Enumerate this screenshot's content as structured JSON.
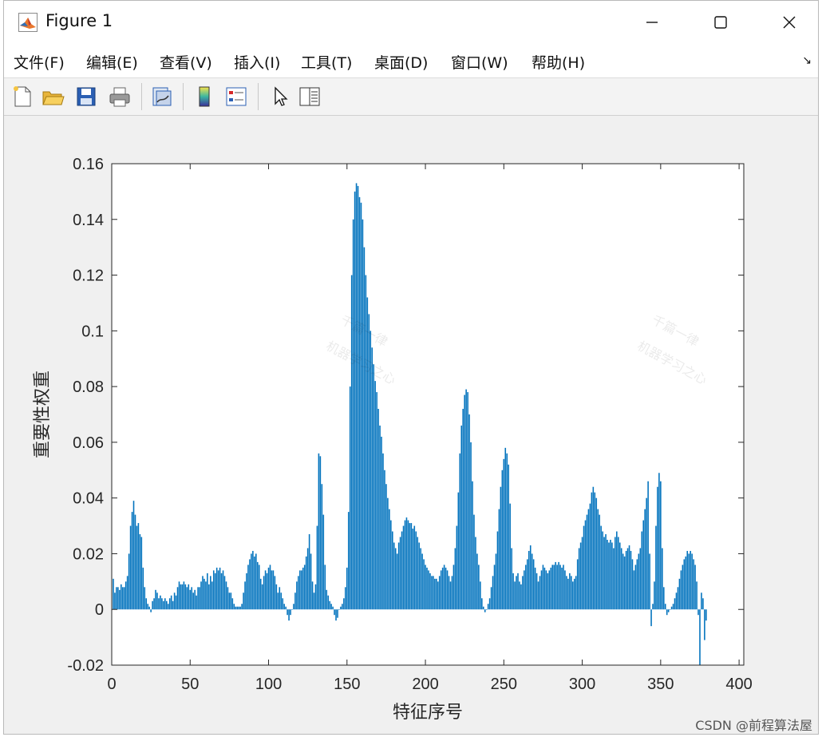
{
  "window": {
    "title": "Figure 1"
  },
  "menu": {
    "items": [
      "文件(F)",
      "编辑(E)",
      "查看(V)",
      "插入(I)",
      "工具(T)",
      "桌面(D)",
      "窗口(W)",
      "帮助(H)"
    ],
    "arrow": "↘"
  },
  "toolbar": {
    "icons": [
      "new-figure-icon",
      "open-file-icon",
      "save-icon",
      "print-icon",
      "link-icon",
      "colorbar-icon",
      "legend-icon",
      "pointer-icon",
      "property-editor-icon"
    ]
  },
  "watermarks": [
    "千篇一律",
    "机器学习之心",
    "千篇一律",
    "机器学习之心"
  ],
  "credit": "CSDN @前程算法屋",
  "chart_data": {
    "type": "bar",
    "title": "",
    "xlabel": "特征序号",
    "ylabel": "重要性权重",
    "xlim": [
      0,
      403
    ],
    "ylim": [
      -0.02,
      0.16
    ],
    "xticks": [
      "0",
      "50",
      "100",
      "150",
      "200",
      "250",
      "300",
      "350",
      "400"
    ],
    "xtick_values": [
      0,
      50,
      100,
      150,
      200,
      250,
      300,
      350,
      400
    ],
    "yticks": [
      "-0.02",
      "0",
      "0.02",
      "0.04",
      "0.06",
      "0.08",
      "0.1",
      "0.12",
      "0.14",
      "0.16"
    ],
    "ytick_values": [
      -0.02,
      0,
      0.02,
      0.04,
      0.06,
      0.08,
      0.1,
      0.12,
      0.14,
      0.16
    ],
    "bar_color": "#0072bd",
    "grid": false,
    "x": [
      1,
      2,
      3,
      4,
      5,
      6,
      7,
      8,
      9,
      10,
      11,
      12,
      13,
      14,
      15,
      16,
      17,
      18,
      19,
      20,
      21,
      22,
      23,
      24,
      25,
      26,
      27,
      28,
      29,
      30,
      31,
      32,
      33,
      34,
      35,
      36,
      37,
      38,
      39,
      40,
      41,
      42,
      43,
      44,
      45,
      46,
      47,
      48,
      49,
      50,
      51,
      52,
      53,
      54,
      55,
      56,
      57,
      58,
      59,
      60,
      61,
      62,
      63,
      64,
      65,
      66,
      67,
      68,
      69,
      70,
      71,
      72,
      73,
      74,
      75,
      76,
      77,
      78,
      79,
      80,
      81,
      82,
      83,
      84,
      85,
      86,
      87,
      88,
      89,
      90,
      91,
      92,
      93,
      94,
      95,
      96,
      97,
      98,
      99,
      100,
      101,
      102,
      103,
      104,
      105,
      106,
      107,
      108,
      109,
      110,
      111,
      112,
      113,
      114,
      115,
      116,
      117,
      118,
      119,
      120,
      121,
      122,
      123,
      124,
      125,
      126,
      127,
      128,
      129,
      130,
      131,
      132,
      133,
      134,
      135,
      136,
      137,
      138,
      139,
      140,
      141,
      142,
      143,
      144,
      145,
      146,
      147,
      148,
      149,
      150,
      151,
      152,
      153,
      154,
      155,
      156,
      157,
      158,
      159,
      160,
      161,
      162,
      163,
      164,
      165,
      166,
      167,
      168,
      169,
      170,
      171,
      172,
      173,
      174,
      175,
      176,
      177,
      178,
      179,
      180,
      181,
      182,
      183,
      184,
      185,
      186,
      187,
      188,
      189,
      190,
      191,
      192,
      193,
      194,
      195,
      196,
      197,
      198,
      199,
      200,
      201,
      202,
      203,
      204,
      205,
      206,
      207,
      208,
      209,
      210,
      211,
      212,
      213,
      214,
      215,
      216,
      217,
      218,
      219,
      220,
      221,
      222,
      223,
      224,
      225,
      226,
      227,
      228,
      229,
      230,
      231,
      232,
      233,
      234,
      235,
      236,
      237,
      238,
      239,
      240,
      241,
      242,
      243,
      244,
      245,
      246,
      247,
      248,
      249,
      250,
      251,
      252,
      253,
      254,
      255,
      256,
      257,
      258,
      259,
      260,
      261,
      262,
      263,
      264,
      265,
      266,
      267,
      268,
      269,
      270,
      271,
      272,
      273,
      274,
      275,
      276,
      277,
      278,
      279,
      280,
      281,
      282,
      283,
      284,
      285,
      286,
      287,
      288,
      289,
      290,
      291,
      292,
      293,
      294,
      295,
      296,
      297,
      298,
      299,
      300,
      301,
      302,
      303,
      304,
      305,
      306,
      307,
      308,
      309,
      310,
      311,
      312,
      313,
      314,
      315,
      316,
      317,
      318,
      319,
      320,
      321,
      322,
      323,
      324,
      325,
      326,
      327,
      328,
      329,
      330,
      331,
      332,
      333,
      334,
      335,
      336,
      337,
      338,
      339,
      340,
      341,
      342,
      343,
      344,
      345,
      346,
      347,
      348,
      349,
      350,
      351,
      352,
      353,
      354,
      355,
      356,
      357,
      358,
      359,
      360,
      361,
      362,
      363,
      364,
      365,
      366,
      367,
      368,
      369,
      370,
      371,
      372,
      373,
      374,
      375,
      376,
      377,
      378,
      379,
      380,
      381,
      382,
      383,
      384,
      385,
      386,
      387,
      388,
      389,
      390,
      391,
      392,
      393,
      394,
      395,
      396,
      397,
      398,
      399,
      400,
      401,
      402,
      403
    ],
    "values": [
      0.011,
      0.006,
      0.008,
      0.008,
      0.007,
      0.009,
      0.008,
      0.008,
      0.01,
      0.012,
      0.02,
      0.03,
      0.035,
      0.039,
      0.034,
      0.03,
      0.031,
      0.027,
      0.026,
      0.015,
      0.008,
      0.004,
      0.002,
      0.001,
      -0.001,
      0.003,
      0.004,
      0.007,
      0.006,
      0.004,
      0.005,
      0.004,
      0.003,
      0.004,
      0.003,
      0.002,
      0.004,
      0.005,
      0.003,
      0.006,
      0.005,
      0.008,
      0.01,
      0.009,
      0.009,
      0.01,
      0.009,
      0.008,
      0.009,
      0.007,
      0.008,
      0.006,
      0.007,
      0.005,
      0.008,
      0.008,
      0.01,
      0.012,
      0.011,
      0.01,
      0.013,
      0.009,
      0.012,
      0.01,
      0.014,
      0.013,
      0.015,
      0.014,
      0.015,
      0.013,
      0.014,
      0.012,
      0.01,
      0.008,
      0.006,
      0.006,
      0.004,
      0.002,
      0.001,
      0.001,
      0.001,
      0.001,
      0.002,
      0.006,
      0.01,
      0.013,
      0.016,
      0.018,
      0.02,
      0.021,
      0.019,
      0.02,
      0.017,
      0.016,
      0.011,
      0.009,
      0.012,
      0.014,
      0.013,
      0.015,
      0.016,
      0.014,
      0.014,
      0.012,
      0.009,
      0.006,
      0.008,
      0.006,
      0.004,
      0.002,
      0.001,
      -0.002,
      -0.004,
      -0.002,
      0.0,
      0.002,
      0.006,
      0.01,
      0.012,
      0.014,
      0.014,
      0.015,
      0.016,
      0.019,
      0.022,
      0.027,
      0.02,
      0.01,
      0.006,
      0.009,
      0.03,
      0.056,
      0.055,
      0.045,
      0.034,
      0.016,
      0.007,
      0.005,
      0.003,
      0.002,
      0.001,
      -0.002,
      -0.004,
      -0.003,
      0.0,
      0.001,
      0.002,
      0.004,
      0.008,
      0.015,
      0.035,
      0.08,
      0.12,
      0.14,
      0.15,
      0.153,
      0.152,
      0.148,
      0.146,
      0.14,
      0.13,
      0.12,
      0.112,
      0.106,
      0.1,
      0.094,
      0.088,
      0.082,
      0.078,
      0.072,
      0.066,
      0.062,
      0.056,
      0.05,
      0.045,
      0.04,
      0.036,
      0.032,
      0.028,
      0.024,
      0.022,
      0.02,
      0.024,
      0.026,
      0.028,
      0.03,
      0.032,
      0.033,
      0.032,
      0.031,
      0.031,
      0.029,
      0.03,
      0.028,
      0.026,
      0.024,
      0.022,
      0.02,
      0.018,
      0.016,
      0.015,
      0.014,
      0.013,
      0.012,
      0.012,
      0.011,
      0.011,
      0.01,
      0.012,
      0.014,
      0.015,
      0.016,
      0.015,
      0.014,
      0.012,
      0.01,
      0.012,
      0.016,
      0.022,
      0.03,
      0.042,
      0.056,
      0.066,
      0.072,
      0.077,
      0.079,
      0.078,
      0.07,
      0.06,
      0.046,
      0.034,
      0.026,
      0.02,
      0.016,
      0.01,
      0.004,
      0.001,
      -0.001,
      0.0,
      0.002,
      0.004,
      0.008,
      0.012,
      0.016,
      0.02,
      0.028,
      0.036,
      0.044,
      0.05,
      0.054,
      0.058,
      0.056,
      0.052,
      0.038,
      0.022,
      0.013,
      0.01,
      0.012,
      0.013,
      0.01,
      0.009,
      0.012,
      0.014,
      0.016,
      0.018,
      0.021,
      0.023,
      0.02,
      0.018,
      0.015,
      0.013,
      0.01,
      0.012,
      0.014,
      0.016,
      0.015,
      0.014,
      0.013,
      0.014,
      0.015,
      0.016,
      0.016,
      0.017,
      0.016,
      0.017,
      0.016,
      0.015,
      0.016,
      0.014,
      0.012,
      0.011,
      0.013,
      0.012,
      0.01,
      0.011,
      0.012,
      0.018,
      0.022,
      0.024,
      0.026,
      0.03,
      0.032,
      0.034,
      0.036,
      0.038,
      0.042,
      0.044,
      0.042,
      0.04,
      0.036,
      0.034,
      0.03,
      0.028,
      0.026,
      0.027,
      0.025,
      0.024,
      0.025,
      0.024,
      0.022,
      0.026,
      0.028,
      0.026,
      0.024,
      0.022,
      0.02,
      0.019,
      0.021,
      0.022,
      0.023,
      0.021,
      0.018,
      0.014,
      0.016,
      0.018,
      0.02,
      0.022,
      0.028,
      0.032,
      0.036,
      0.04,
      0.046,
      0.02,
      -0.006,
      0.002,
      0.01,
      0.03,
      0.044,
      0.049,
      0.046,
      0.022,
      0.008,
      0.002,
      -0.002,
      -0.001,
      0.0,
      0.001,
      0.002,
      0.004,
      0.006,
      0.008,
      0.011,
      0.014,
      0.016,
      0.018,
      0.019,
      0.021,
      0.02,
      0.021,
      0.02,
      0.018,
      0.016,
      0.01,
      -0.002,
      -0.02,
      0.006,
      0.004,
      -0.011,
      -0.004
    ]
  }
}
